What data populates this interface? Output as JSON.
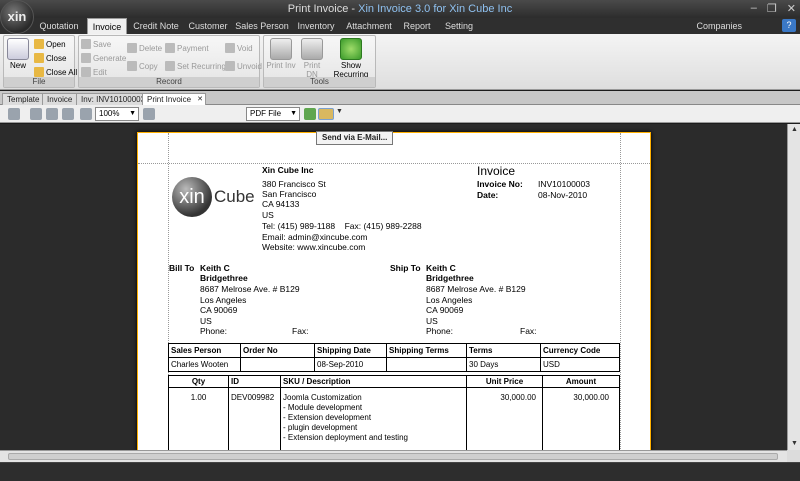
{
  "window": {
    "title": "Print Invoice",
    "separator": " - ",
    "subtitle": "Xin Invoice 3.0 for Xin Cube Inc",
    "orb_label": "xin",
    "controls": [
      "–",
      "❐",
      "✕"
    ]
  },
  "ribbon_tabs": [
    "Quotation",
    "Invoice",
    "Credit Note",
    "Customer",
    "Sales Person",
    "Inventory",
    "Attachment",
    "Report",
    "Setting"
  ],
  "active_tab": "Invoice",
  "companies_label": "Companies",
  "help_label": "?",
  "ribbon": {
    "file": {
      "title": "File",
      "new": "New",
      "open": "Open",
      "close": "Close",
      "close_all": "Close All"
    },
    "record": {
      "title": "Record",
      "save": "Save",
      "generate": "Generate",
      "edit": "Edit",
      "delete": "Delete",
      "copy": "Copy",
      "payment": "Payment",
      "set_recurring": "Set Recurring",
      "void": "Void",
      "unvoid": "Unvoid"
    },
    "tools": {
      "title": "Tools",
      "print_inv": "Print Inv",
      "print_dn": "Print DN",
      "show_recurring": "Show Recurring"
    }
  },
  "doc_tabs": [
    "Template",
    "Invoice",
    "Inv: INV10100003",
    "Print Invoice"
  ],
  "doc_tab_close": "✕",
  "toolbar": {
    "zoom": "100%",
    "export_format": "PDF File"
  },
  "tooltip": "Send via E-Mail...",
  "colors": {
    "tab_bg": "#2f2f2f",
    "paper_border": "#ffb000",
    "accent": "#8fc1f0"
  },
  "invoice": {
    "logo_mark": "xin",
    "logo_word": "Cube",
    "company": {
      "name": "Xin Cube Inc",
      "address1": "380 Francisco St",
      "address2": "San Francisco",
      "address3": "CA 94133",
      "country": "US",
      "tel_label": "Tel:",
      "tel": "(415) 989-1188",
      "fax_label": "Fax:",
      "fax": "(415) 989-2288",
      "email_label": "Email:",
      "email": "admin@xincube.com",
      "website_label": "Website:",
      "website": "www.xincube.com"
    },
    "doc_title": "Invoice",
    "invoice_no_label": "Invoice No:",
    "invoice_no": "INV10100003",
    "date_label": "Date:",
    "date": "08-Nov-2010",
    "bill_to": {
      "label": "Bill To",
      "name": "Keith C",
      "company": "Bridgethree",
      "line1": "8687 Melrose Ave. # B129",
      "line2": "Los Angeles",
      "line3": "CA 90069",
      "country": "US",
      "phone_label": "Phone:",
      "fax_label": "Fax:"
    },
    "ship_to": {
      "label": "Ship To",
      "name": "Keith C",
      "company": "Bridgethree",
      "line1": "8687 Melrose Ave. # B129",
      "line2": "Los Angeles",
      "line3": "CA 90069",
      "country": "US",
      "phone_label": "Phone:",
      "fax_label": "Fax:"
    },
    "meta_headers": [
      "Sales Person",
      "Order No",
      "Shipping Date",
      "Shipping Terms",
      "Terms",
      "Currency Code"
    ],
    "meta_values": [
      "Charles Wooten",
      "",
      "08-Sep-2010",
      "",
      "30 Days",
      "USD"
    ],
    "item_headers": [
      "Qty",
      "ID",
      "SKU / Description",
      "Unit Price",
      "Amount"
    ],
    "items": [
      {
        "qty": "1.00",
        "id": "DEV009982",
        "desc": [
          "Joomla Customization",
          "- Module development",
          "- Extension development",
          "- plugin development",
          "- Extension deployment and testing"
        ],
        "unit_price": "30,000.00",
        "amount": "30,000.00"
      }
    ]
  }
}
